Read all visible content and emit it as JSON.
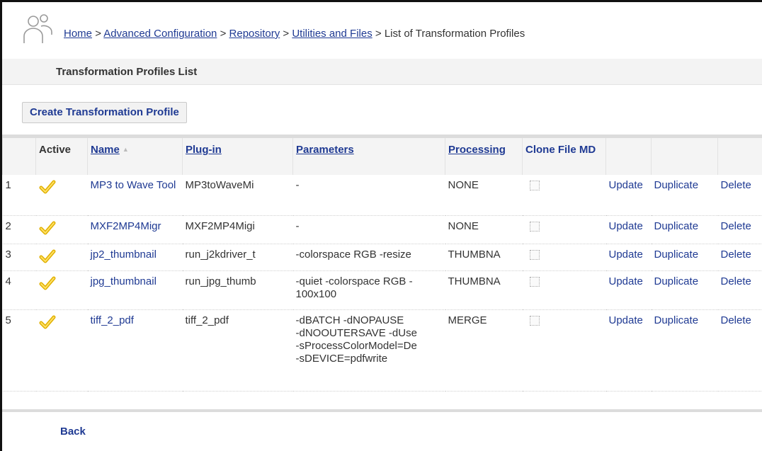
{
  "breadcrumb": {
    "home": "Home",
    "advanced_configuration": "Advanced Configuration",
    "repository": "Repository",
    "utilities_and_files": "Utilities and Files",
    "current": "List of Transformation Profiles",
    "separator": ">"
  },
  "panel": {
    "title": "Transformation Profiles List"
  },
  "toolbar": {
    "create_label": "Create Transformation Profile"
  },
  "grid": {
    "headers": {
      "active": "Active",
      "name": "Name",
      "plugin": "Plug-in",
      "parameters": "Parameters",
      "processing": "Processing",
      "clone_file_md": "Clone File MD"
    },
    "sort_indicator": "▲",
    "action_labels": {
      "update": "Update",
      "duplicate": "Duplicate",
      "delete": "Delete"
    },
    "rows": [
      {
        "index": "1",
        "active": true,
        "name": "MP3 to Wave Tool",
        "plugin": "MP3toWaveMi -",
        "plugin_text": "MP3toWaveMi",
        "parameters": [
          "-"
        ],
        "processing": "NONE",
        "clone_file_md": false
      },
      {
        "index": "2",
        "active": true,
        "name": "MXF2MP4Migr",
        "plugin_text": "MXF2MP4Migi",
        "parameters": [
          "-"
        ],
        "processing": "NONE",
        "clone_file_md": false
      },
      {
        "index": "3",
        "active": true,
        "name": "jp2_thumbnail",
        "plugin_text": "run_j2kdriver_t",
        "parameters": [
          "-colorspace RGB -resize"
        ],
        "processing": "THUMBNA",
        "clone_file_md": false
      },
      {
        "index": "4",
        "active": true,
        "name": "jpg_thumbnail",
        "plugin_text": "run_jpg_thumb",
        "parameters": [
          "-quiet -colorspace RGB -",
          "100x100"
        ],
        "processing": "THUMBNA",
        "clone_file_md": false
      },
      {
        "index": "5",
        "active": true,
        "name": "tiff_2_pdf",
        "plugin_text": "tiff_2_pdf",
        "parameters": [
          "-dBATCH -dNOPAUSE",
          "-dNOOUTERSAVE -dUse",
          "-sProcessColorModel=De",
          "-sDEVICE=pdfwrite"
        ],
        "processing": "MERGE",
        "clone_file_md": false
      }
    ]
  },
  "footer": {
    "back_label": "Back"
  },
  "colors": {
    "link": "#1f3a93",
    "check": "#f2c200",
    "header_bg": "#f4f4f4"
  },
  "icons": {
    "user": "user-group-icon",
    "active": "check-icon"
  }
}
